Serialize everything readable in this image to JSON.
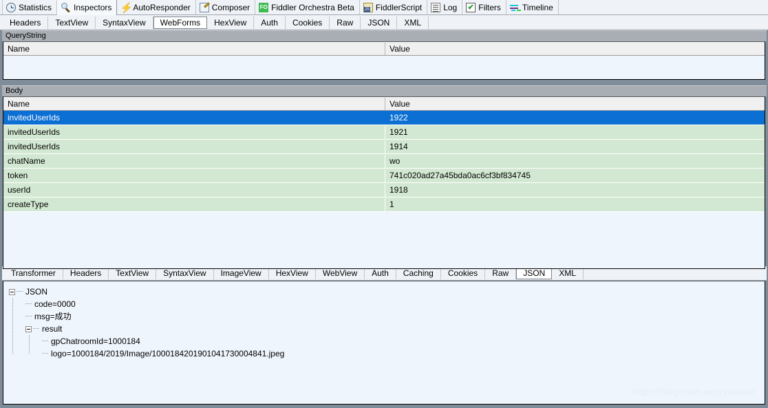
{
  "main_tabs": [
    {
      "label": "Statistics",
      "icon": "clock-icon",
      "selected": false
    },
    {
      "label": "Inspectors",
      "icon": "magnifier-icon",
      "selected": true
    },
    {
      "label": "AutoResponder",
      "icon": "bolt-icon",
      "selected": false
    },
    {
      "label": "Composer",
      "icon": "composer-icon",
      "selected": false
    },
    {
      "label": "Fiddler Orchestra Beta",
      "icon": "fo-badge-icon",
      "selected": false
    },
    {
      "label": "FiddlerScript",
      "icon": "script-icon",
      "selected": false
    },
    {
      "label": "Log",
      "icon": "log-icon",
      "selected": false
    },
    {
      "label": "Filters",
      "icon": "filters-checkbox-icon",
      "selected": false
    },
    {
      "label": "Timeline",
      "icon": "timeline-icon",
      "selected": false
    }
  ],
  "request_tabs": [
    {
      "label": "Headers",
      "selected": false
    },
    {
      "label": "TextView",
      "selected": false
    },
    {
      "label": "SyntaxView",
      "selected": false
    },
    {
      "label": "WebForms",
      "selected": true
    },
    {
      "label": "HexView",
      "selected": false
    },
    {
      "label": "Auth",
      "selected": false
    },
    {
      "label": "Cookies",
      "selected": false
    },
    {
      "label": "Raw",
      "selected": false
    },
    {
      "label": "JSON",
      "selected": false
    },
    {
      "label": "XML",
      "selected": false
    }
  ],
  "querystring": {
    "group_label": "QueryString",
    "columns": {
      "name": "Name",
      "value": "Value"
    },
    "rows": []
  },
  "body": {
    "group_label": "Body",
    "columns": {
      "name": "Name",
      "value": "Value"
    },
    "rows": [
      {
        "name": "invitedUserIds",
        "value": "1922",
        "selected": true
      },
      {
        "name": "invitedUserIds",
        "value": "1921",
        "selected": false
      },
      {
        "name": "invitedUserIds",
        "value": "1914",
        "selected": false
      },
      {
        "name": "chatName",
        "value": "wo",
        "selected": false
      },
      {
        "name": "token",
        "value": "741c020ad27a45bda0ac6cf3bf834745",
        "selected": false
      },
      {
        "name": "userId",
        "value": "1918",
        "selected": false
      },
      {
        "name": "createType",
        "value": "1",
        "selected": false
      }
    ]
  },
  "response_tabs": [
    {
      "label": "Transformer",
      "selected": false
    },
    {
      "label": "Headers",
      "selected": false
    },
    {
      "label": "TextView",
      "selected": false
    },
    {
      "label": "SyntaxView",
      "selected": false
    },
    {
      "label": "ImageView",
      "selected": false
    },
    {
      "label": "HexView",
      "selected": false
    },
    {
      "label": "WebView",
      "selected": false
    },
    {
      "label": "Auth",
      "selected": false
    },
    {
      "label": "Caching",
      "selected": false
    },
    {
      "label": "Cookies",
      "selected": false
    },
    {
      "label": "Raw",
      "selected": false
    },
    {
      "label": "JSON",
      "selected": true
    },
    {
      "label": "XML",
      "selected": false
    }
  ],
  "json_tree": {
    "root_label": "JSON",
    "code": "code=0000",
    "msg": "msg=成功",
    "result_label": "result",
    "gp_chatroom_id": "gpChatroomId=1000184",
    "logo": "logo=1000184/2019/Image/1000184201901041730004841.jpeg"
  },
  "watermark": "https://blog.csdn.net/zyoooxie",
  "colors": {
    "selection_blue": "#0B6FD4",
    "row_green": "#D2E8D2",
    "pane_gray": "#7F8C99",
    "empty_blue": "#EFF5FC"
  }
}
